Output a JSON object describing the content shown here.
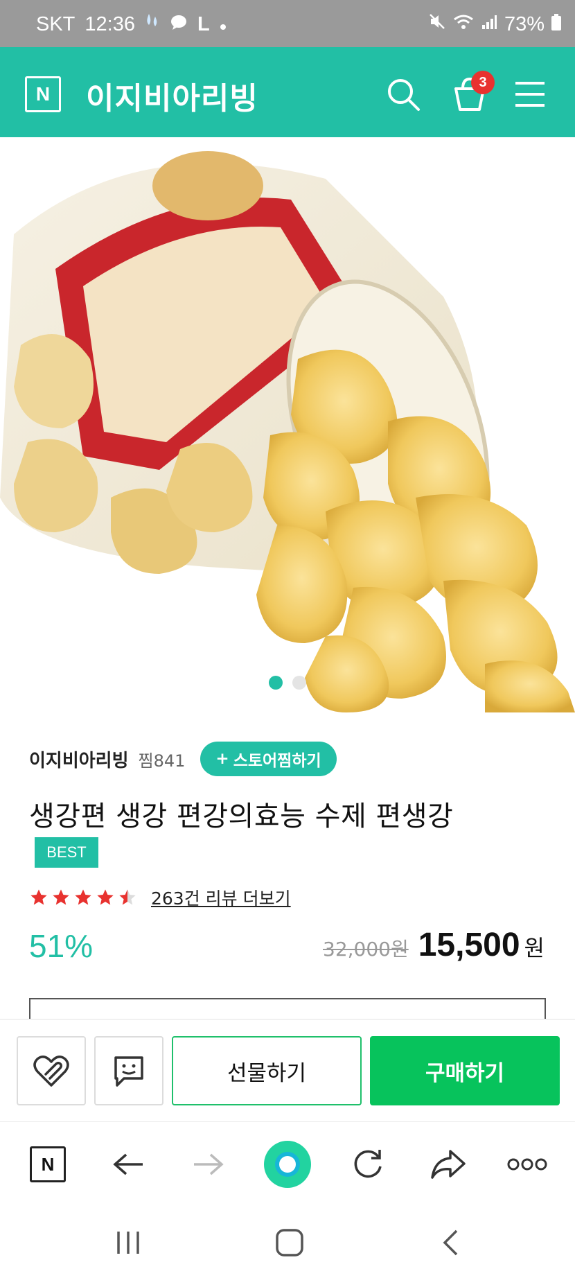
{
  "status_bar": {
    "carrier": "SKT",
    "time": "12:36",
    "app_letter": "L",
    "battery": "73%"
  },
  "header": {
    "logo": "N",
    "store_title": "이지비아리빙",
    "cart_count": "3"
  },
  "product_image": {
    "slide_count": 2,
    "active_slide": 1
  },
  "product": {
    "store_name": "이지비아리빙",
    "zzim": "찜841",
    "follow_label": "스토어찜하기",
    "title": "생강편 생강 편강의효능 수제 편생강",
    "badge": "BEST",
    "rating": 4.5,
    "review_link": "263건 리뷰 더보기",
    "discount": "51%",
    "original_price": "32,000원",
    "sale_price": "15,500",
    "currency": "원"
  },
  "bottom_bar": {
    "gift_label": "선물하기",
    "buy_label": "구매하기"
  },
  "browser_toolbar": {
    "logo": "N"
  },
  "colors": {
    "brand": "#22bfa5",
    "buy": "#07c35c",
    "badge_red": "#e8322f",
    "star": "#e8322f"
  }
}
